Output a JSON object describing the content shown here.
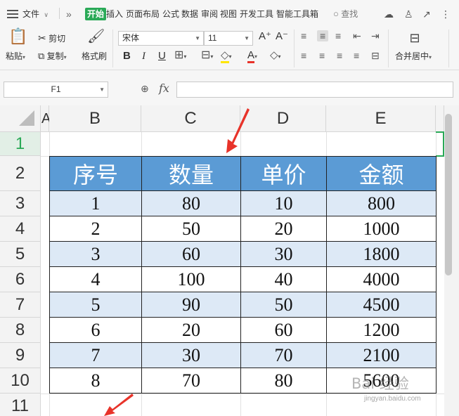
{
  "menu": {
    "file_label": "文件",
    "chevron": "∨",
    "more": "»",
    "tabs": [
      "开始",
      "插入",
      "页面布局",
      "公式",
      "数据",
      "审阅",
      "视图",
      "开发工具",
      "智能工具箱"
    ],
    "search_label": "查找"
  },
  "ribbon": {
    "paste_label": "粘贴",
    "cut_label": "剪切",
    "copy_label": "复制",
    "format_painter_label": "格式刷",
    "font_name": "宋体",
    "font_size": "11",
    "bold": "B",
    "italic": "I",
    "underline": "U",
    "font_color_glyph": "A",
    "increase_font": "A⁺",
    "decrease_font": "A⁻",
    "merge_label": "合并居中"
  },
  "formula_bar": {
    "cell_ref": "F1",
    "fx": "fx",
    "formula": ""
  },
  "columns": [
    "A",
    "B",
    "C",
    "D",
    "E"
  ],
  "rows": [
    "1",
    "2",
    "3",
    "4",
    "5",
    "6",
    "7",
    "8",
    "9",
    "10",
    "11"
  ],
  "table": {
    "headers": [
      "序号",
      "数量",
      "单价",
      "金额"
    ],
    "rows": [
      [
        "1",
        "80",
        "10",
        "800"
      ],
      [
        "2",
        "50",
        "20",
        "1000"
      ],
      [
        "3",
        "60",
        "30",
        "1800"
      ],
      [
        "4",
        "100",
        "40",
        "4000"
      ],
      [
        "5",
        "90",
        "50",
        "4500"
      ],
      [
        "6",
        "20",
        "60",
        "1200"
      ],
      [
        "7",
        "30",
        "70",
        "2100"
      ],
      [
        "8",
        "70",
        "80",
        "5600"
      ]
    ]
  },
  "watermark": {
    "text": "Bai 经验",
    "sub": "jingyan.baidu.com"
  },
  "colors": {
    "accent": "#2aa957",
    "table_header": "#5b9bd5",
    "band": "#dde9f6",
    "annotation": "#e8332a"
  }
}
